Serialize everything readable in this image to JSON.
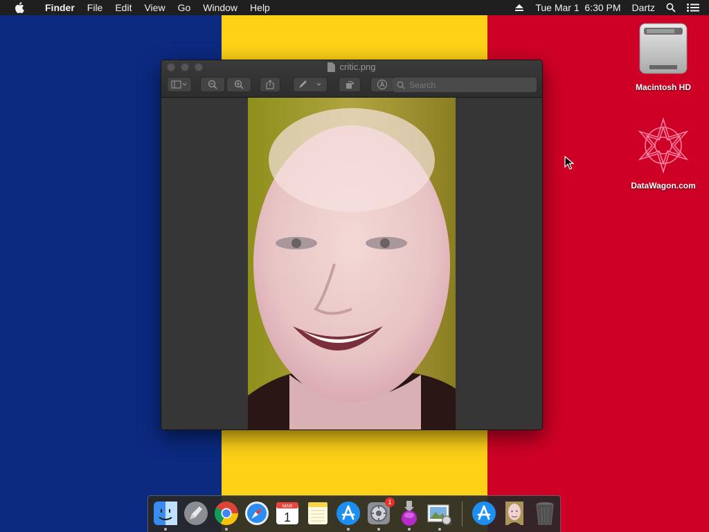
{
  "colors": {
    "flag_blue": "#0b2a80",
    "flag_yellow": "#fdd116",
    "flag_red": "#cf0026",
    "menubar": "#1f1f1f",
    "window": "#363636"
  },
  "menubar": {
    "apple": "apple-icon",
    "app_name": "Finder",
    "items": [
      "File",
      "Edit",
      "View",
      "Go",
      "Window",
      "Help"
    ],
    "clock": "Tue Mar 1  6:30 PM",
    "user": "Dartz",
    "icons": [
      "eject-icon",
      "spotlight-search-icon",
      "notification-center-icon"
    ]
  },
  "desktop": {
    "icons": [
      {
        "label": "Macintosh HD",
        "icon": "hard-drive-icon"
      },
      {
        "label": "DataWagon.com",
        "icon": "flower-logo-icon"
      }
    ]
  },
  "window": {
    "title": "critic.png",
    "search_placeholder": "Search",
    "toolbar": [
      "sidebar-toggle-icon",
      "zoom-out-icon",
      "zoom-in-icon",
      "share-icon",
      "markup-pen-icon",
      "rotate-icon",
      "annotate-icon"
    ]
  },
  "dock": {
    "items": [
      {
        "name": "finder-icon",
        "running": true
      },
      {
        "name": "launchpad-icon",
        "running": false
      },
      {
        "name": "chrome-icon",
        "running": true
      },
      {
        "name": "safari-icon",
        "running": false
      },
      {
        "name": "calendar-icon",
        "running": false,
        "month": "MAR",
        "day": "1"
      },
      {
        "name": "notes-icon",
        "running": false
      },
      {
        "name": "app-store-icon",
        "running": true
      },
      {
        "name": "system-preferences-icon",
        "running": true,
        "badge": "1"
      },
      {
        "name": "installer-icon",
        "running": true
      },
      {
        "name": "preview-icon",
        "running": true
      },
      {
        "name": "app-store-downloads-icon",
        "running": false
      },
      {
        "name": "image-document-icon",
        "running": false
      },
      {
        "name": "trash-icon",
        "running": false
      }
    ]
  }
}
